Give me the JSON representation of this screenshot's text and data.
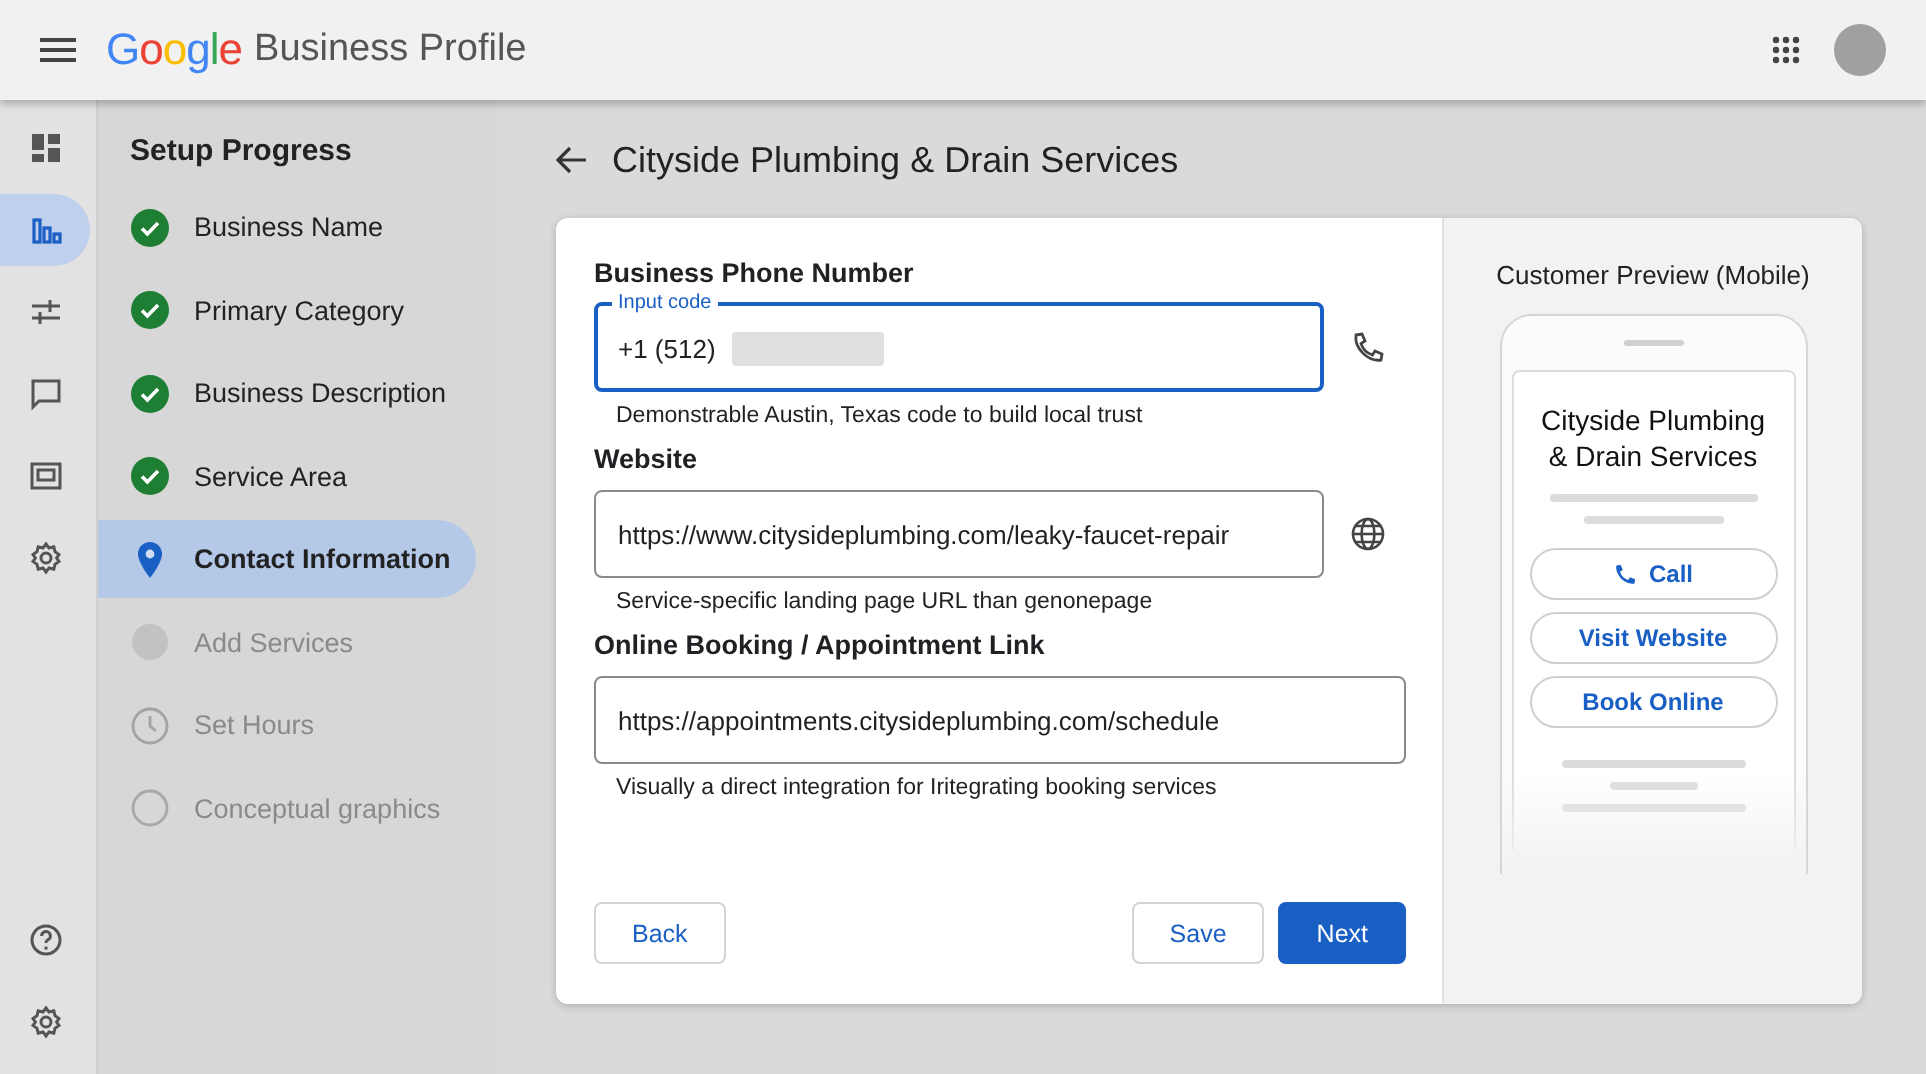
{
  "header": {
    "brand_letters": [
      {
        "char": "G",
        "color": "#4285f4"
      },
      {
        "char": "o",
        "color": "#ea4335"
      },
      {
        "char": "o",
        "color": "#fbbc05"
      },
      {
        "char": "g",
        "color": "#4285f4"
      },
      {
        "char": "l",
        "color": "#34a853"
      },
      {
        "char": "e",
        "color": "#ea4335"
      }
    ],
    "product": "Business Profile"
  },
  "rail": {
    "items": [
      {
        "kind": "dashboard",
        "selected": false
      },
      {
        "kind": "chart",
        "selected": true
      },
      {
        "kind": "tune",
        "selected": false
      },
      {
        "kind": "chat",
        "selected": false
      },
      {
        "kind": "slides",
        "selected": false
      },
      {
        "kind": "settings",
        "selected": false
      }
    ],
    "bottom": [
      {
        "kind": "help",
        "selected": false
      },
      {
        "kind": "settings",
        "selected": false
      }
    ]
  },
  "steps": {
    "title": "Setup Progress",
    "items": [
      {
        "label": "Business Name",
        "kind": "done",
        "selected": false
      },
      {
        "label": "Primary Category",
        "kind": "done",
        "selected": false
      },
      {
        "label": "Business Description",
        "kind": "done",
        "selected": false
      },
      {
        "label": "Service Area",
        "kind": "done",
        "selected": false
      },
      {
        "label": "Contact Information",
        "kind": "current",
        "selected": true
      },
      {
        "label": "Add Services",
        "kind": "dot",
        "selected": false
      },
      {
        "label": "Set Hours",
        "kind": "clock",
        "selected": false
      },
      {
        "label": "Conceptual graphics",
        "kind": "circle",
        "selected": false
      }
    ]
  },
  "page_title": "Cityside Plumbing & Drain Services",
  "form": {
    "fields": [
      {
        "label": "Business Phone Number",
        "floating_label": "Input code",
        "value": "+1 (512)",
        "masked": true,
        "focused": true,
        "kind": "phone",
        "hint": "Demonstrable Austin, Texas code to build local trust"
      },
      {
        "label": "Website",
        "value": "https://www.citysideplumbing.com/leaky-faucet-repair",
        "masked": false,
        "focused": false,
        "kind": "website",
        "hint": "Service-specific landing page URL than genonepage"
      },
      {
        "label": "Online Booking / Appointment Link",
        "value": "https://appointments.citysideplumbing.com/schedule",
        "masked": false,
        "focused": false,
        "kind": "booking",
        "hint": "Visually a direct integration for Iritegrating booking services"
      }
    ],
    "back": "Back",
    "save": "Save",
    "next": "Next"
  },
  "preview": {
    "title": "Customer Preview (Mobile)",
    "business": "Cityside Plumbing & Drain Services",
    "buttons": [
      {
        "label": "Call",
        "kind": "call"
      },
      {
        "label": "Visit Website",
        "kind": "website"
      },
      {
        "label": "Book Online",
        "kind": "booking"
      }
    ]
  }
}
